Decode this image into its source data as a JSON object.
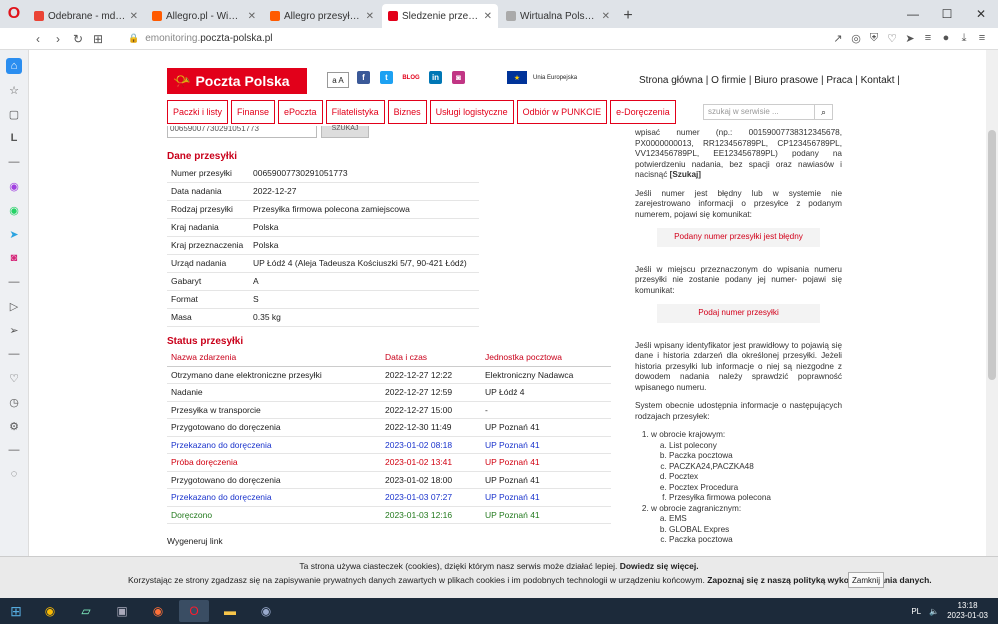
{
  "browser": {
    "tabs": [
      {
        "title": "Odebrane - mdrogeria@gr",
        "color": "#ea4335",
        "active": false
      },
      {
        "title": "Allegro.pl - Więcej niż aukc",
        "color": "#ff5a00",
        "active": false
      },
      {
        "title": "Allegro przesyłka polecona",
        "color": "#ff5a00",
        "active": false
      },
      {
        "title": "Śledzenie przesyłek - Track",
        "color": "#e2001a",
        "active": true
      },
      {
        "title": "Wirtualna Polska - Wszystko",
        "color": "#aaaaaa",
        "active": false
      }
    ],
    "url_prefix": "emonitoring.",
    "url_domain": "poczta-polska.pl"
  },
  "site": {
    "logo_text": "Poczta Polska",
    "font_size_btn": "a A",
    "eu_label": "Unia Europejska",
    "blog_label": "BLOG",
    "top_links": "Strona główna | O firmie | Biuro prasowe | Praca | Kontakt |",
    "nav": [
      "Paczki i listy",
      "Finanse",
      "ePoczta",
      "Filatelistyka",
      "Biznes",
      "Usługi logistyczne",
      "Odbiór w PUNKCIE",
      "e-Doręczenia"
    ],
    "search_placeholder": "szukaj w serwisie ...",
    "input_value": "00659007730291051773",
    "search_button": "SZUKAJ"
  },
  "dane": {
    "title": "Dane przesyłki",
    "rows": [
      {
        "k": "Numer przesyłki",
        "v": "00659007730291051773"
      },
      {
        "k": "Data nadania",
        "v": "2022-12-27"
      },
      {
        "k": "Rodzaj przesyłki",
        "v": "Przesyłka firmowa polecona zamiejscowa"
      },
      {
        "k": "Kraj nadania",
        "v": "Polska"
      },
      {
        "k": "Kraj przeznaczenia",
        "v": "Polska"
      },
      {
        "k": "Urząd nadania",
        "v": "UP Łódź 4 (Aleja Tadeusza Kościuszki 5/7, 90-421 Łódź)"
      },
      {
        "k": "Gabaryt",
        "v": "A"
      },
      {
        "k": "Format",
        "v": "S"
      },
      {
        "k": "Masa",
        "v": "0.35 kg"
      }
    ]
  },
  "status": {
    "title": "Status przesyłki",
    "headers": [
      "Nazwa zdarzenia",
      "Data i czas",
      "Jednostka pocztowa"
    ],
    "rows": [
      {
        "event": "Otrzymano dane elektroniczne przesyłki",
        "date": "2022-12-27 12:22",
        "unit": "Elektroniczny Nadawca",
        "style": ""
      },
      {
        "event": "Nadanie",
        "date": "2022-12-27 12:59",
        "unit": "UP Łódź 4",
        "style": ""
      },
      {
        "event": "Przesyłka w transporcie",
        "date": "2022-12-27 15:00",
        "unit": "-",
        "style": ""
      },
      {
        "event": "Przygotowano do doręczenia",
        "date": "2022-12-30 11:49",
        "unit": "UP Poznań 41",
        "style": ""
      },
      {
        "event": "Przekazano do doręczenia",
        "date": "2023-01-02 08:18",
        "unit": "UP Poznań 41",
        "style": "blue"
      },
      {
        "event": "Próba doręczenia",
        "date": "2023-01-02 13:41",
        "unit": "UP Poznań 41",
        "style": "red"
      },
      {
        "event": "Przygotowano do doręczenia",
        "date": "2023-01-02 18:00",
        "unit": "UP Poznań 41",
        "style": ""
      },
      {
        "event": "Przekazano do doręczenia",
        "date": "2023-01-03 07:27",
        "unit": "UP Poznań 41",
        "style": "blue"
      },
      {
        "event": "Doręczono",
        "date": "2023-01-03 12:16",
        "unit": "UP Poznań 41",
        "style": "green"
      }
    ],
    "gen_link": "Wygeneruj link"
  },
  "help": {
    "p1": "wpisać numer (np.: 00159007738312345678, PX0000000013, RR123456789PL, CP123456789PL, VV123456789PL, EE123456789PL) podany na potwierdzeniu nadania, bez spacji oraz nawiasów i nacisnąć",
    "p1_bold": "[Szukaj]",
    "p2": "Jeśli numer jest błędny lub w systemie nie zarejestrowano informacji o przesyłce z podanym numerem, pojawi się komunikat:",
    "hint1": "Podany numer przesyłki jest błędny",
    "p3": "Jeśli w miejscu przeznaczonym do wpisania numeru przesyłki nie zostanie podany jej numer- pojawi się komunikat:",
    "hint2": "Podaj numer przesyłki",
    "p4": "Jeśli wpisany identyfikator jest prawidłowy to pojawią się dane i historia zdarzeń dla określonej przesyłki. Jeżeli historia przesyłki lub informacje o niej są niezgodne z dowodem nadania należy sprawdzić poprawność wpisanego numeru.",
    "p5": "System obecnie udostępnia informacje o następujących rodzajach przesyłek:",
    "domestic": "w obrocie krajowym:",
    "domestic_items": [
      "List polecony",
      "Paczka pocztowa",
      "PACZKA24,PACZKA48",
      "Pocztex",
      "Pocztex Procedura",
      "Przesyłka firmowa polecona"
    ],
    "foreign": "w obrocie zagranicznym:",
    "foreign_items": [
      "EMS",
      "GLOBAL Expres",
      "Paczka pocztowa"
    ]
  },
  "cookies": {
    "line1": "Ta strona używa ciasteczek (cookies), dzięki którym nasz serwis może działać lepiej.",
    "line1_link": "Dowiedz się więcej.",
    "line2": "Korzystając ze strony zgadzasz się na zapisywanie prywatnych danych zawartych w plikach cookies i im podobnych technologii w urządzeniu końcowym.",
    "line2_link": "Zapoznaj się z naszą polityką wykorzystywania danych.",
    "close": "Zamknij"
  },
  "taskbar": {
    "lang": "PL",
    "time": "13:18",
    "date": "2023-01-03"
  }
}
